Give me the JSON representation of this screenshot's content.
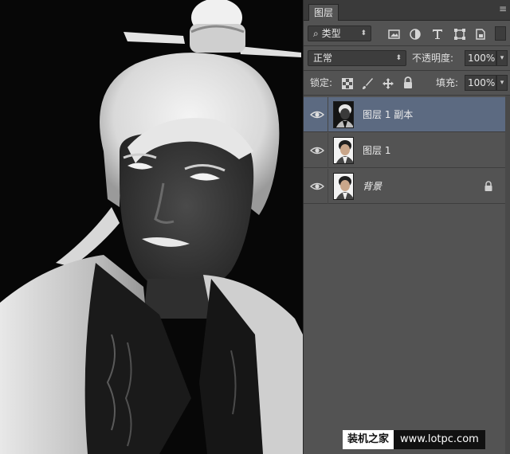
{
  "panel": {
    "tab_label": "图层",
    "tab_menu_icon": "panel-menu-icon",
    "filter": {
      "search_glyph": "⌕",
      "kind_label": "类型",
      "icons": [
        "image-filter-icon",
        "adjustment-filter-icon",
        "type-filter-icon",
        "shape-filter-icon",
        "smart-object-filter-icon"
      ]
    },
    "blend": {
      "mode": "正常",
      "opacity_label": "不透明度:",
      "opacity_value": "100%"
    },
    "lock_row": {
      "lock_label": "锁定:",
      "icons": [
        "lock-transparent-icon",
        "lock-paint-icon",
        "lock-position-icon",
        "lock-all-icon"
      ],
      "fill_label": "填充:",
      "fill_value": "100%"
    },
    "layers": [
      {
        "name": "图层 1 副本",
        "selected": true,
        "visible": true,
        "locked": false,
        "italic": false,
        "inverted": true
      },
      {
        "name": "图层 1",
        "selected": false,
        "visible": true,
        "locked": false,
        "italic": false,
        "inverted": false
      },
      {
        "name": "背景",
        "selected": false,
        "visible": true,
        "locked": true,
        "italic": true,
        "inverted": false
      }
    ]
  },
  "watermark": {
    "brand": "装机之家",
    "url": "www.lotpc.com"
  },
  "colors": {
    "panel_bg": "#535353",
    "selected_layer": "#5c6a81",
    "field_bg": "#3d3d3d"
  }
}
